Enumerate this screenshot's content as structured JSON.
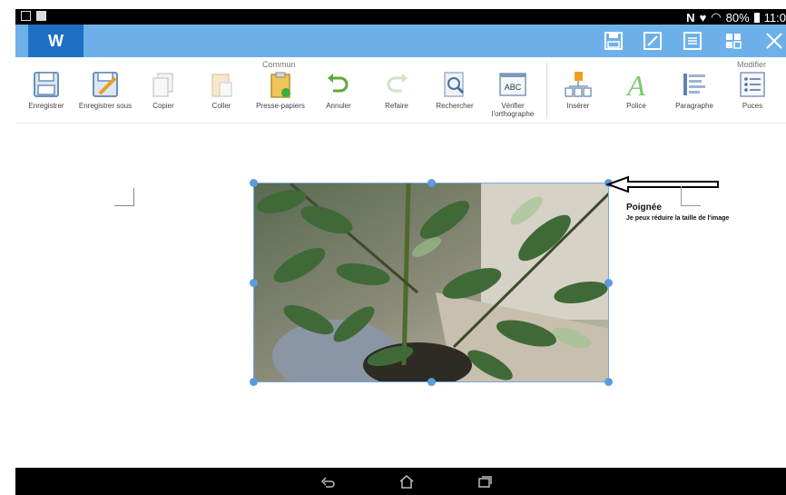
{
  "status_bar": {
    "battery": "80%",
    "time": "11:0"
  },
  "app_bar": {
    "logo": "W",
    "icons": [
      "save-icon",
      "edit-icon",
      "list-icon",
      "grid-icon",
      "close-icon"
    ]
  },
  "ribbon": {
    "groups": [
      {
        "label": "Commun"
      },
      {
        "label": "Modifier"
      }
    ],
    "tools": [
      {
        "label": "Enregistrer",
        "icon": "floppy-icon"
      },
      {
        "label": "Enregistrer sous",
        "icon": "floppy-pencil-icon"
      },
      {
        "label": "Copier",
        "icon": "copy-icon"
      },
      {
        "label": "Coller",
        "icon": "paste-icon"
      },
      {
        "label": "Presse-papiers",
        "icon": "clipboard-icon"
      },
      {
        "label": "Annuler",
        "icon": "undo-icon"
      },
      {
        "label": "Refaire",
        "icon": "redo-icon"
      },
      {
        "label": "Rechercher",
        "icon": "search-icon"
      },
      {
        "label": "Vérifier l'orthographe",
        "icon": "spellcheck-icon",
        "icon_text": "ABC"
      },
      {
        "label": "Insérer",
        "icon": "insert-icon"
      },
      {
        "label": "Police",
        "icon": "font-icon",
        "icon_text": "A"
      },
      {
        "label": "Paragraphe",
        "icon": "paragraph-icon"
      },
      {
        "label": "Puces",
        "icon": "bullets-icon"
      }
    ]
  },
  "document": {
    "callout_title": "Poignée",
    "callout_text": "Je peux réduire la taille de l'image"
  },
  "colors": {
    "app_bar": "#6db0ea",
    "logo_bg": "#1e6fc4",
    "handle": "#5b9be0"
  }
}
